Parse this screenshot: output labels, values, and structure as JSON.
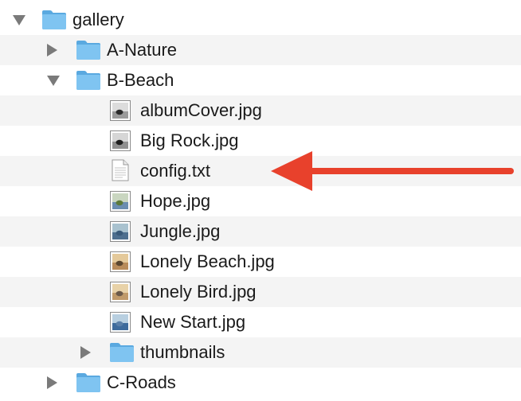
{
  "tree": [
    {
      "label": "gallery",
      "kind": "folder",
      "depth": 0,
      "expanded": true,
      "icon": "folder-icon"
    },
    {
      "label": "A-Nature",
      "kind": "folder",
      "depth": 1,
      "expanded": false,
      "icon": "folder-icon"
    },
    {
      "label": "B-Beach",
      "kind": "folder",
      "depth": 1,
      "expanded": true,
      "icon": "folder-icon"
    },
    {
      "label": "albumCover.jpg",
      "kind": "image",
      "depth": 2,
      "icon": "image-thumbnail-icon"
    },
    {
      "label": "Big Rock.jpg",
      "kind": "image",
      "depth": 2,
      "icon": "image-thumbnail-icon"
    },
    {
      "label": "config.txt",
      "kind": "text",
      "depth": 2,
      "icon": "text-file-icon"
    },
    {
      "label": "Hope.jpg",
      "kind": "image",
      "depth": 2,
      "icon": "image-thumbnail-icon"
    },
    {
      "label": "Jungle.jpg",
      "kind": "image",
      "depth": 2,
      "icon": "image-thumbnail-icon"
    },
    {
      "label": "Lonely Beach.jpg",
      "kind": "image",
      "depth": 2,
      "icon": "image-thumbnail-icon"
    },
    {
      "label": "Lonely Bird.jpg",
      "kind": "image",
      "depth": 2,
      "icon": "image-thumbnail-icon"
    },
    {
      "label": "New Start.jpg",
      "kind": "image",
      "depth": 2,
      "icon": "image-thumbnail-icon"
    },
    {
      "label": "thumbnails",
      "kind": "folder",
      "depth": 2,
      "expanded": false,
      "icon": "folder-icon"
    },
    {
      "label": "C-Roads",
      "kind": "folder",
      "depth": 1,
      "expanded": false,
      "icon": "folder-icon"
    }
  ],
  "annotation": {
    "icon": "red-arrow-icon",
    "points_to": "config.txt",
    "color": "#e8412c"
  },
  "colors": {
    "folder": "#7fc4f1",
    "row_alt": "#f4f4f4",
    "disclosure": "#7a7a7a"
  }
}
